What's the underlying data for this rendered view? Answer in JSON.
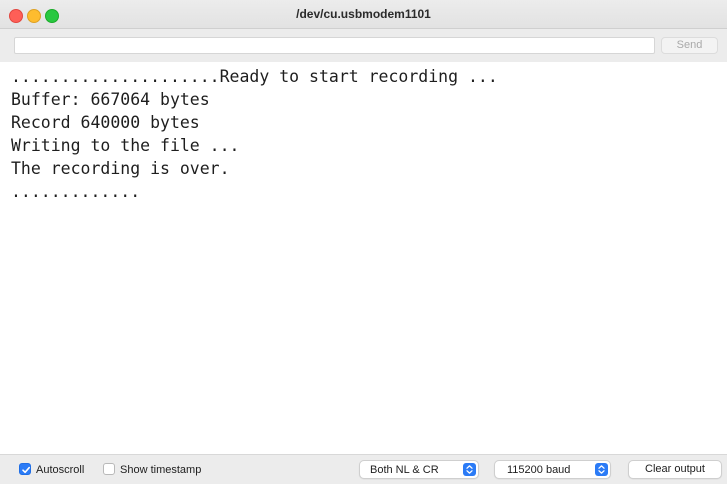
{
  "window": {
    "title": "/dev/cu.usbmodem1101"
  },
  "input": {
    "value": "",
    "placeholder": "",
    "send_label": "Send"
  },
  "output": {
    "lines": [
      ".....................Ready to start recording ...",
      "Buffer: 667064 bytes",
      "Record 640000 bytes",
      "Writing to the file ...",
      "The recording is over.",
      "............."
    ]
  },
  "bottom": {
    "autoscroll_label": "Autoscroll",
    "autoscroll_checked": true,
    "timestamp_label": "Show timestamp",
    "timestamp_checked": false,
    "line_ending": "Both NL & CR",
    "baud": "115200 baud",
    "clear_label": "Clear output"
  },
  "colors": {
    "accent": "#2b7bf6",
    "close": "#fe5f57",
    "minimize": "#febc2e",
    "maximize": "#28c840"
  }
}
